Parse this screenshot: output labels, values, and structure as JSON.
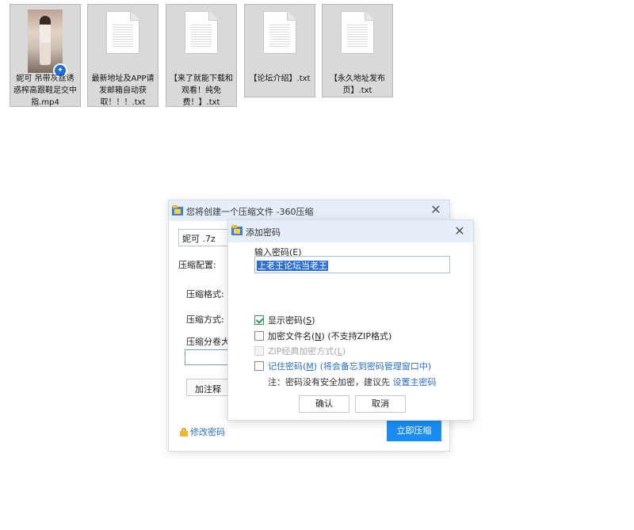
{
  "desktop": {
    "files": [
      {
        "name": "妮可 吊带灰丝诱惑榨高跟鞋足交中指.mp4",
        "type": "video"
      },
      {
        "name": "最新地址及APP请发邮箱自动获取！！！.txt",
        "type": "text"
      },
      {
        "name": "【来了就能下载和观看！纯免费！】.txt",
        "type": "text"
      },
      {
        "name": "【论坛介绍】.txt",
        "type": "text"
      },
      {
        "name": "【永久地址发布页】.txt",
        "type": "text"
      }
    ]
  },
  "main_dialog": {
    "title": "您将创建一个压缩文件 -360压缩",
    "filename": "妮可 .7z",
    "config_label": "压缩配置:",
    "format_label": "压缩格式:",
    "method_label": "压缩方式:",
    "volume_label": "压缩分卷大",
    "note_button": "加注释",
    "change_password_link": "修改密码",
    "compress_button": "立即压缩"
  },
  "password_dialog": {
    "title": "添加密码",
    "input_label": "输入密码(",
    "input_label_key": "E",
    "input_label_end": ")",
    "password_value": "上老王论坛当老王",
    "options": {
      "show_password": {
        "label": "显示密码(",
        "key": "S",
        "end": ")",
        "checked": true
      },
      "encrypt_filenames": {
        "label": "加密文件名(",
        "key": "N",
        "end": ") (不支持ZIP格式)",
        "checked": false
      },
      "zip_classic": {
        "label": "ZIP经典加密方式(",
        "key": "L",
        "end": ")",
        "checked": false,
        "disabled": true
      },
      "remember_password": {
        "label": "记住密码(",
        "key": "M",
        "end": ")",
        "suffix": " (将会备忘到密码管理窗口中)",
        "checked": false
      }
    },
    "note_text": "注：密码没有安全加密，建议先 ",
    "note_link": "设置主密码",
    "ok_button": "确认",
    "cancel_button": "取消"
  },
  "colors": {
    "accent": "#1b8df2",
    "link": "#2a6ccc",
    "titlebar": "#e6eff9",
    "selection": "#2d6fd1"
  }
}
